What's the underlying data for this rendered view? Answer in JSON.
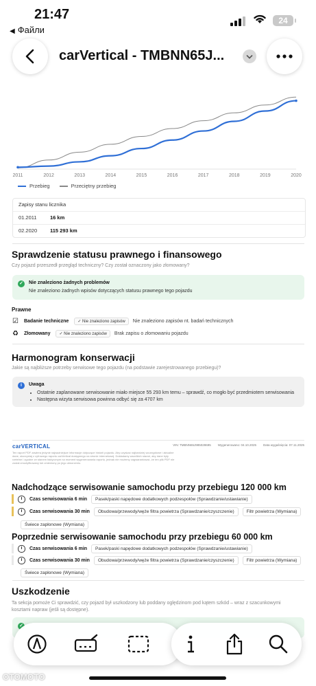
{
  "status_bar": {
    "time": "21:47",
    "back_app": "Файли",
    "battery": "24"
  },
  "header": {
    "title": "carVertical - TMBNN65J..."
  },
  "chart_data": {
    "type": "line",
    "x": [
      "2011",
      "2012",
      "2013",
      "2014",
      "2015",
      "2016",
      "2017",
      "2018",
      "2019",
      "2020"
    ],
    "series": [
      {
        "name": "Przebieg",
        "color": "#2f6fd6",
        "values": [
          3000,
          5000,
          12000,
          22000,
          34000,
          48000,
          63000,
          79000,
          96000,
          113000
        ]
      },
      {
        "name": "Przeciętny przebieg",
        "color": "#888888",
        "values": [
          2000,
          15000,
          28000,
          41000,
          54000,
          67000,
          80000,
          93000,
          106000,
          119000
        ]
      }
    ],
    "legend_position": "bottom-left"
  },
  "odometer": {
    "title": "Zapisy stanu licznika",
    "rows": [
      {
        "date": "01.2011",
        "value": "16 km"
      },
      {
        "date": "02.2020",
        "value": "115 293 km"
      }
    ]
  },
  "legal": {
    "title": "Sprawdzenie statusu prawnego i finansowego",
    "subtitle": "Czy pojazd przeszedł przegląd techniczny? Czy został oznaczony jako złomowany?",
    "ok_title": "Nie znaleziono żadnych problemów",
    "ok_text": "Nie znaleziono żadnych wpisów dotyczących statusu prawnego tego pojazdu",
    "section": "Prawne",
    "items": [
      {
        "label": "Badanie techniczne",
        "chip": "✓ Nie znaleziono zapisów",
        "desc": "Nie znaleziono zapisów nt. badań technicznych"
      },
      {
        "label": "Złomowany",
        "chip": "✓ Nie znaleziono zapisów",
        "desc": "Brak zapisu o złomowaniu pojazdu"
      }
    ]
  },
  "maintenance": {
    "title": "Harmonogram konserwacji",
    "subtitle": "Jakie są najbliższe potrzeby serwisowe tego pojazdu (na podstawie zarejestrowanego przebiegu)?",
    "note_title": "Uwaga",
    "bullets": [
      "Ostatnie zaplanowane serwisowanie miało miejsce 55 293 km temu – sprawdź, co mogło być przedmiotem serwisowania",
      "Następna wizyta serwisowa powinna odbyć się za 4707 km"
    ]
  },
  "doc_footer": {
    "logo": "carVERTICAL",
    "vin": "VIN: TMBNN65J985028695",
    "generated": "Wygenerowano: 04.10.2025",
    "expiry": "Data wygaśnięcia: 07.11.2025",
    "note": "Ten raport PDF zawiera jedynie najważniejsze informacje dotyczące historii pojazdu. Aby uzyskać najbardziej szczegółowe i aktualne dane, skorzystaj z cyfrowego raportu carVertical dostępnego na stronie internetowej. Dokładamy wszelkich starań, aby dane były rzetelne i zgodne ze stanem faktycznym na moment wygenerowania raportu, jednak nie możemy zagwarantować, że ten plik PDF nie został zmodyfikowany lub zmieniony po jego utworzeniu."
  },
  "upcoming": {
    "title": "Nadchodzące serwisowanie samochodu przy przebiegu 120 000 km",
    "rows": [
      {
        "label": "Czas serwisowania 6 min",
        "tags": [
          "Pasek/paski napędowe dodatkowych podzespołów (Sprawdzanie/ustawianie)"
        ]
      },
      {
        "label": "Czas serwisowania 30 min",
        "tags": [
          "Obudowa/przewody/węże filtra powietrza (Sprawdzanie/czyszczenie)",
          "Filtr powietrza (Wymiana)"
        ],
        "extra": "Świece zapłonowe (Wymiana)"
      }
    ]
  },
  "previous": {
    "title": "Poprzednie serwisowanie samochodu przy przebiegu 60 000 km",
    "rows": [
      {
        "label": "Czas serwisowania 6 min",
        "tags": [
          "Pasek/paski napędowe dodatkowych podzespołów (Sprawdzanie/ustawianie)"
        ]
      },
      {
        "label": "Czas serwisowania 30 min",
        "tags": [
          "Obudowa/przewody/węże filtra powietrza (Sprawdzanie/czyszczenie)",
          "Filtr powietrza (Wymiana)"
        ],
        "extra": "Świece zapłonowe (Wymiana)"
      }
    ]
  },
  "damage": {
    "title": "Uszkodzenie",
    "subtitle": "Ta sekcja pomoże Ci sprawdzić, czy pojazd był uszkodzony lub poddany oględzinom pod kątem szkód – wraz z szacunkowymi kosztami napraw (jeśli są dostępne)."
  },
  "watermark": "OTOMOTO",
  "colors": {
    "accent": "#2f6fd6",
    "ok_bg": "#e8f6ec",
    "ok_icon": "#2fa85a",
    "info_bg": "#f0f0f0",
    "info_icon": "#2f6fd6",
    "bar_yellow": "#e8c15a"
  }
}
